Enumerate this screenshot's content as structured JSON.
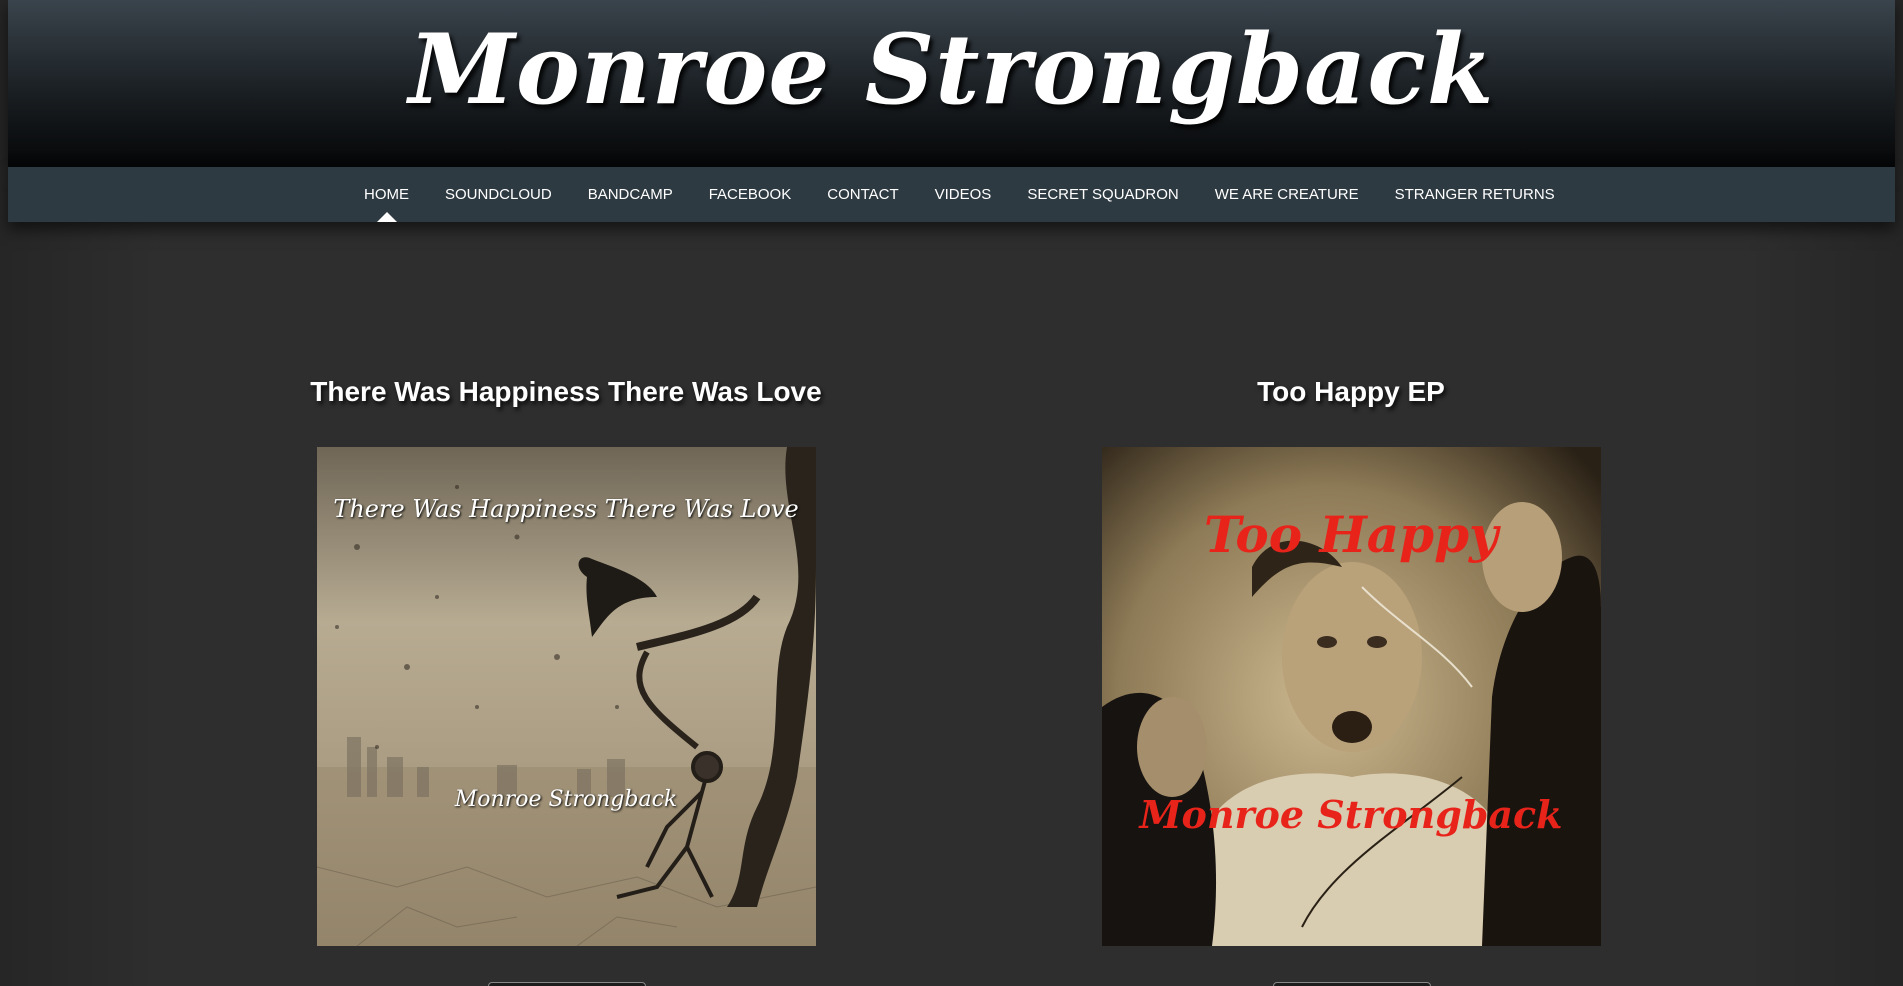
{
  "header": {
    "title": "Monroe Strongback"
  },
  "nav": {
    "items": [
      {
        "label": "HOME",
        "active": true
      },
      {
        "label": "SOUNDCLOUD"
      },
      {
        "label": "BANDCAMP"
      },
      {
        "label": "FACEBOOK"
      },
      {
        "label": "CONTACT"
      },
      {
        "label": "VIDEOS"
      },
      {
        "label": "SECRET SQUADRON"
      },
      {
        "label": "WE ARE CREATURE"
      },
      {
        "label": "STRANGER RETURNS"
      }
    ]
  },
  "albums": [
    {
      "title": "There Was Happiness There Was Love",
      "cover_title": "There Was Happiness There Was Love",
      "cover_artist": "Monroe Strongback"
    },
    {
      "title": "Too Happy EP",
      "cover_title": "Too Happy",
      "cover_artist": "Monroe Strongback"
    }
  ],
  "colors": {
    "header_top": "#3a444c",
    "header_bottom": "#050607",
    "nav_bg": "#2e3a42",
    "page_bg": "#2e2e2e",
    "cover2_text": "#e8231a"
  }
}
